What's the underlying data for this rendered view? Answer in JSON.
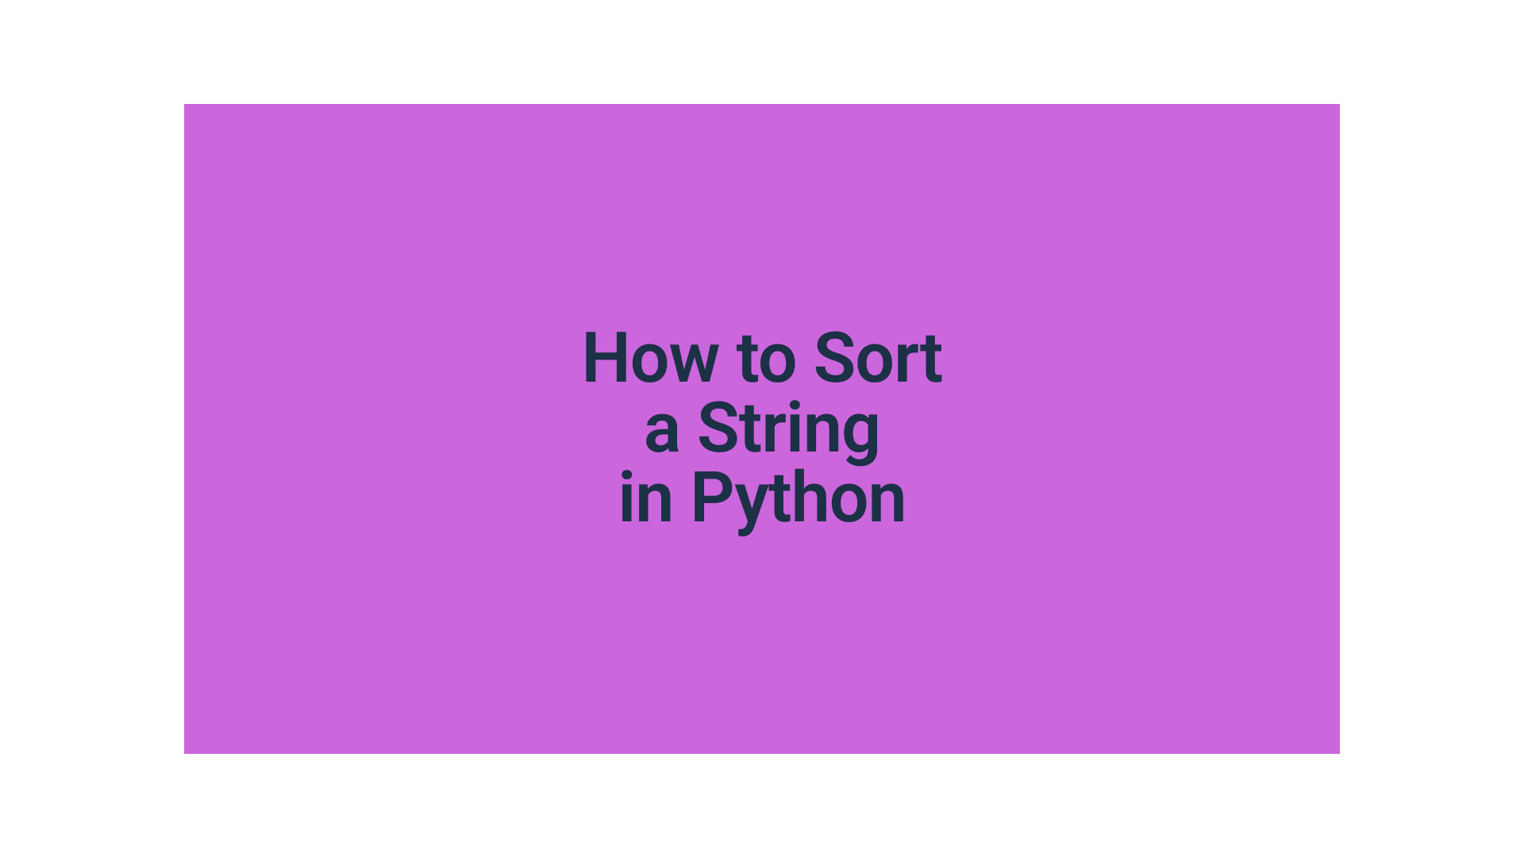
{
  "title": {
    "line1": "How to Sort",
    "line2": "a String",
    "line3": "in Python"
  },
  "colors": {
    "background": "#cc66dd",
    "text": "#1c3046"
  }
}
